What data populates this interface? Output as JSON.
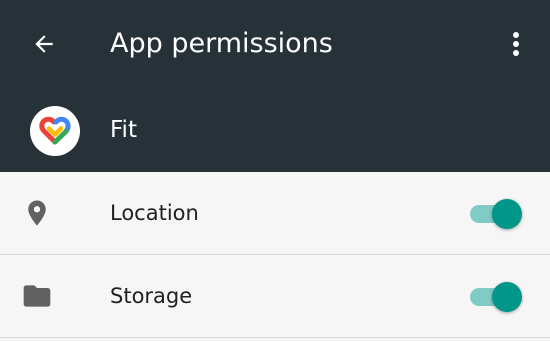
{
  "toolbar": {
    "title": "App permissions",
    "back_icon": "arrow-back-icon",
    "overflow_icon": "more-vert-icon"
  },
  "app": {
    "name": "Fit",
    "icon": "google-fit-heart-icon"
  },
  "permissions": [
    {
      "label": "Location",
      "icon": "location-pin-icon",
      "enabled": true
    },
    {
      "label": "Storage",
      "icon": "folder-icon",
      "enabled": true
    }
  ],
  "colors": {
    "toolbar_bg": "#263238",
    "list_bg": "#f6f6f6",
    "switch_thumb": "#009688",
    "switch_track": "#80cbc4",
    "icon_gray": "#616161"
  }
}
